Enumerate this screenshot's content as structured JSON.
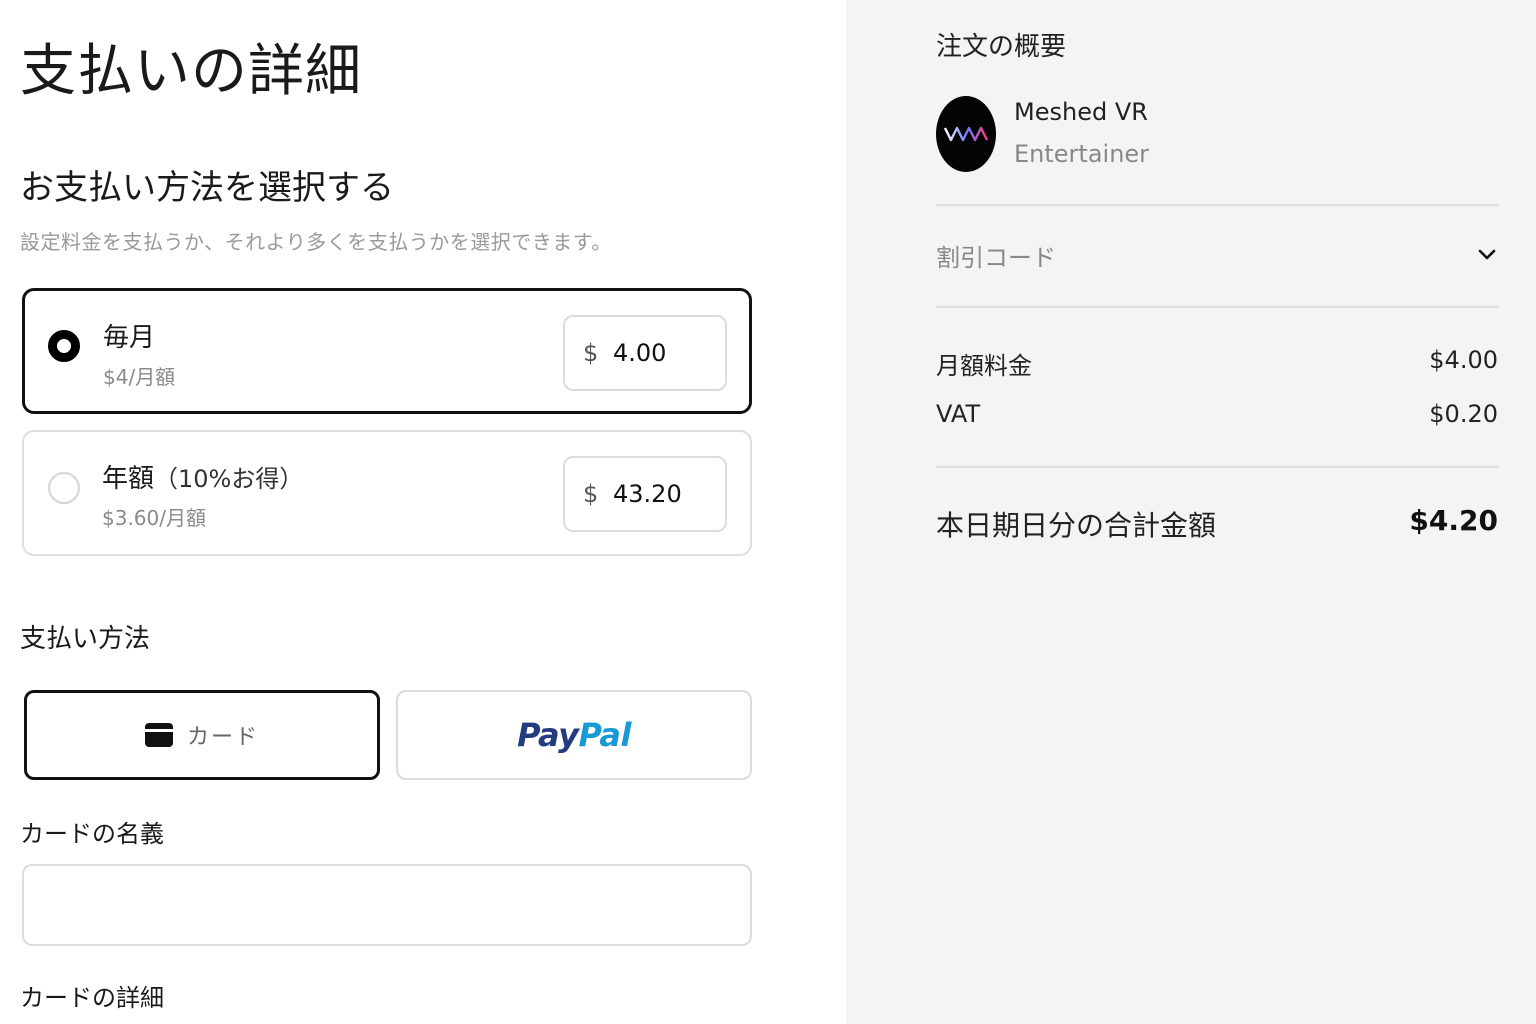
{
  "payment": {
    "title": "支払いの詳細",
    "select_title": "お支払い方法を選択する",
    "select_subtitle": "設定料金を支払うか、それより多くを支払うかを選択できます。",
    "plans": [
      {
        "name": "毎月",
        "note": "",
        "price": "$4/月額",
        "currency": "$",
        "amount": "4.00",
        "selected": true
      },
      {
        "name": "年額",
        "note": "（10%お得）",
        "price": "$3.60/月額",
        "currency": "$",
        "amount": "43.20",
        "selected": false
      }
    ],
    "method_title": "支払い方法",
    "methods": {
      "card_label": "カード",
      "card_icon": "card-icon",
      "paypal_pay": "Pay",
      "paypal_pal": "Pal"
    },
    "cardholder_label": "カードの名義",
    "cardholder_value": "",
    "card_details_label": "カードの詳細"
  },
  "summary": {
    "title": "注文の概要",
    "creator_name": "Meshed VR",
    "creator_role": "Entertainer",
    "discount_label": "割引コード",
    "rows": [
      {
        "label": "月額料金",
        "value": "$4.00"
      },
      {
        "label": "VAT",
        "value": "$0.20"
      }
    ],
    "total_label": "本日期日分の合計金額",
    "total_value": "$4.20"
  },
  "colors": {
    "accent": "#111111",
    "summary_bg": "#f4f4f4",
    "paypal_dark": "#253b80",
    "paypal_light": "#179bd7"
  }
}
